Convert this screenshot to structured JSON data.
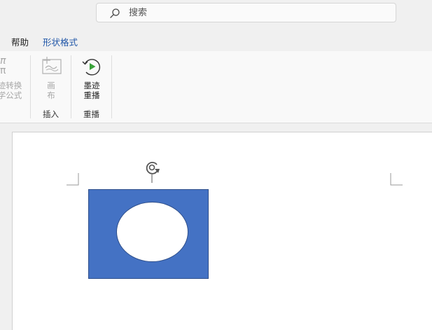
{
  "search": {
    "placeholder": "搜索"
  },
  "tabs": [
    {
      "label": "帮助",
      "active": false
    },
    {
      "label": "形状格式",
      "active": true
    }
  ],
  "ribbon": {
    "ink_to_math": {
      "line1": "迹转换",
      "line2": "学公式",
      "glyph": "π"
    },
    "canvas": {
      "line1": "画",
      "line2": "布"
    },
    "ink_replay": {
      "line1": "墨迹",
      "line2": "重播"
    },
    "groups": {
      "insert": "插入",
      "replay": "重播"
    }
  },
  "colors": {
    "accent": "#1f55a7",
    "shape_fill": "#4472c4",
    "replay_play": "#3aa23a"
  },
  "icons": {
    "search": "search-icon",
    "ink_to_math": "ink-math-icon",
    "canvas": "canvas-icon",
    "ink_replay": "ink-replay-icon",
    "rotate": "rotate-icon"
  }
}
